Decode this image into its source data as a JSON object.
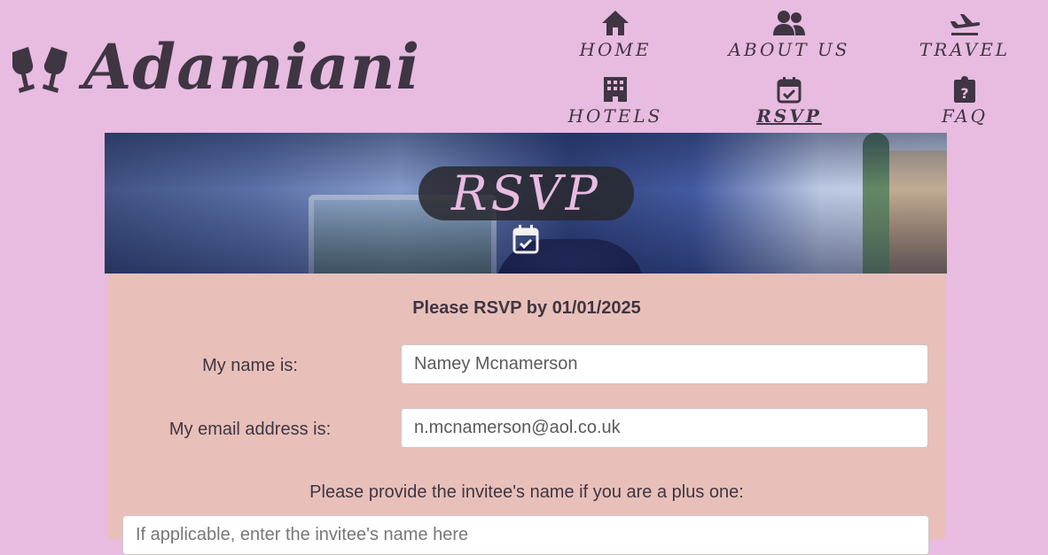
{
  "brand": {
    "name": "Adamiani",
    "icon": "champagne-glasses-icon"
  },
  "nav": {
    "items": [
      {
        "label": "HOME",
        "icon": "home-icon",
        "active": false
      },
      {
        "label": "ABOUT US",
        "icon": "users-icon",
        "active": false
      },
      {
        "label": "TRAVEL",
        "icon": "plane-icon",
        "active": false
      },
      {
        "label": "HOTELS",
        "icon": "hotel-icon",
        "active": false
      },
      {
        "label": "RSVP",
        "icon": "calendar-check-icon",
        "active": true
      },
      {
        "label": "FAQ",
        "icon": "clipboard-question-icon",
        "active": false
      }
    ]
  },
  "hero": {
    "title": "RSVP",
    "icon": "calendar-check-icon"
  },
  "form": {
    "deadline": "Please RSVP by 01/01/2025",
    "name_label": "My name is:",
    "name_value": "Namey Mcnamerson",
    "email_label": "My email address is:",
    "email_value": "n.mcnamerson@aol.co.uk",
    "plus_one_label": "Please provide the invitee's name if you are a plus one:",
    "plus_one_placeholder": "If applicable, enter the invitee's name here"
  },
  "colors": {
    "background": "#e8bbe0",
    "panel": "#e8c0b9",
    "text": "#3f3543",
    "title_badge": "#28282d"
  }
}
